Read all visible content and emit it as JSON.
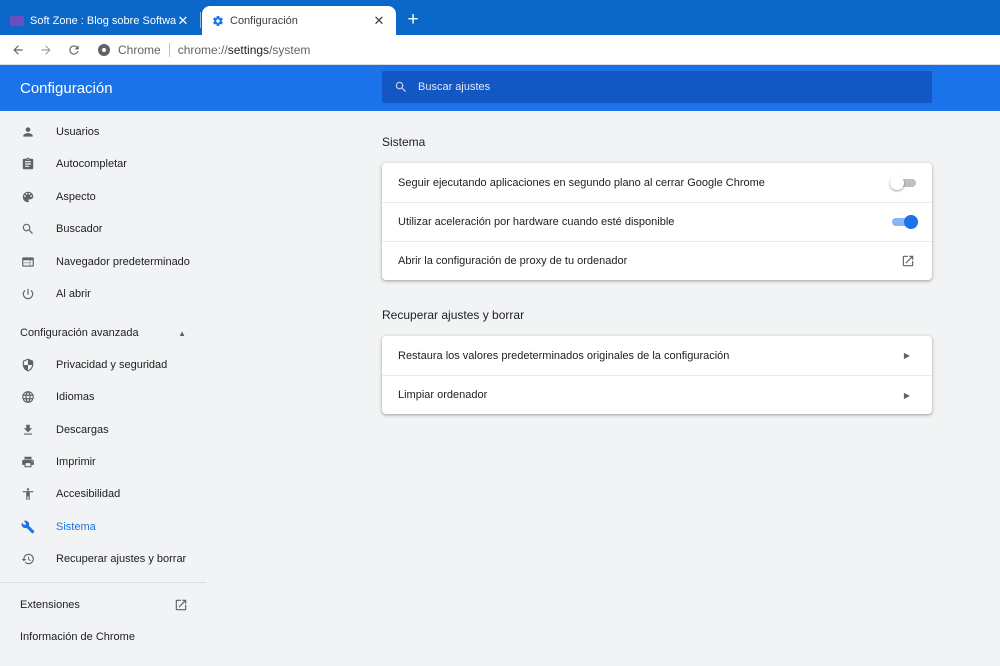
{
  "browser": {
    "tabs": [
      {
        "title": "Soft Zone : Blog sobre Software ",
        "active": false
      },
      {
        "title": "Configuración",
        "active": true
      }
    ],
    "address": {
      "chip": "Chrome",
      "scheme": "chrome://",
      "host": "settings",
      "path": "/system"
    }
  },
  "header": {
    "title": "Configuración",
    "search_placeholder": "Buscar ajustes"
  },
  "sidebar": {
    "items": [
      {
        "label": "Usuarios",
        "icon": "person-icon"
      },
      {
        "label": "Autocompletar",
        "icon": "clipboard-icon"
      },
      {
        "label": "Aspecto",
        "icon": "palette-icon"
      },
      {
        "label": "Buscador",
        "icon": "search-icon"
      },
      {
        "label": "Navegador predeterminado",
        "icon": "browser-window-icon"
      },
      {
        "label": "Al abrir",
        "icon": "power-icon"
      }
    ],
    "advanced_label": "Configuración avanzada",
    "advanced_items": [
      {
        "label": "Privacidad y seguridad",
        "icon": "shield-icon"
      },
      {
        "label": "Idiomas",
        "icon": "globe-icon"
      },
      {
        "label": "Descargas",
        "icon": "download-icon"
      },
      {
        "label": "Imprimir",
        "icon": "printer-icon"
      },
      {
        "label": "Accesibilidad",
        "icon": "accessibility-icon"
      },
      {
        "label": "Sistema",
        "icon": "wrench-icon",
        "selected": true
      },
      {
        "label": "Recuperar ajustes y borrar",
        "icon": "history-icon"
      }
    ],
    "extensions_label": "Extensiones",
    "about_label": "Información de Chrome"
  },
  "main": {
    "system": {
      "title": "Sistema",
      "rows": [
        {
          "label": "Seguir ejecutando aplicaciones en segundo plano al cerrar Google Chrome",
          "toggle": false
        },
        {
          "label": "Utilizar aceleración por hardware cuando esté disponible",
          "toggle": true
        },
        {
          "label": "Abrir la configuración de proxy de tu ordenador"
        }
      ]
    },
    "reset": {
      "title": "Recuperar ajustes y borrar",
      "rows": [
        {
          "label": "Restaura los valores predeterminados originales de la configuración"
        },
        {
          "label": "Limpiar ordenador"
        }
      ]
    }
  },
  "colors": {
    "tabstrip": "#0c68c8",
    "header": "#1a73e8",
    "accent": "#1a73e8",
    "background": "#f1f3f4"
  }
}
